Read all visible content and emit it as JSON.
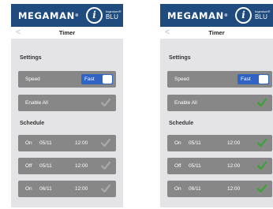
{
  "app": {
    "brand_name": "MEGAMAN",
    "brand_reg": "®",
    "logo_glyph": "i",
    "logo_small": "Ingenium®",
    "logo_sub": "BLU",
    "brand_color": "#1f4b7e"
  },
  "nav": {
    "back_glyph": "<",
    "title": "Timer"
  },
  "settings": {
    "title": "Settings",
    "speed_label": "Speed",
    "speed_value": "Fast",
    "enable_all_label": "Enable All"
  },
  "schedule": {
    "title": "Schedule",
    "entries": [
      {
        "state": "On",
        "date": "05/11",
        "time": "12:00"
      },
      {
        "state": "Off",
        "date": "05/11",
        "time": "12:00"
      },
      {
        "state": "On",
        "date": "06/11",
        "time": "12:00"
      }
    ]
  },
  "colors": {
    "check_inactive": "#a9a9a9",
    "check_active": "#3ca33a",
    "toggle_bg": "#2f64c4",
    "row_bg": "#878787"
  }
}
